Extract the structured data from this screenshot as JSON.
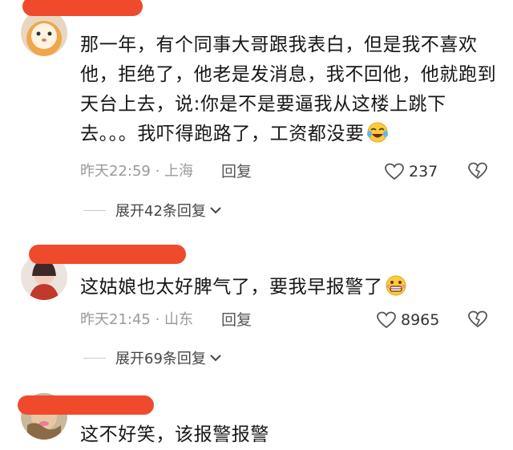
{
  "comments": [
    {
      "text": "那一年，有个同事大哥跟我表白，但是我不喜欢他，拒绝了，他老是发消息，我不回他，他就跑到天台上去，说:你是不是要逼我从这楼上跳下去。。。我吓得跑路了，工资都没要",
      "emoji": "laughing-crying-emoji",
      "time": "昨天22:59 · 上海",
      "reply_label": "回复",
      "likes": "237",
      "expand_label": "展开42条回复"
    },
    {
      "text": "这姑娘也太好脾气了，要我早报警了",
      "emoji": "grimacing-emoji",
      "time": "昨天21:45 · 山东",
      "reply_label": "回复",
      "likes": "8965",
      "expand_label": "展开69条回复"
    },
    {
      "text": "这不好笑，该报警报警"
    }
  ],
  "colors": {
    "redaction": "#f04a2c",
    "meta_text": "#9a9a9a"
  }
}
